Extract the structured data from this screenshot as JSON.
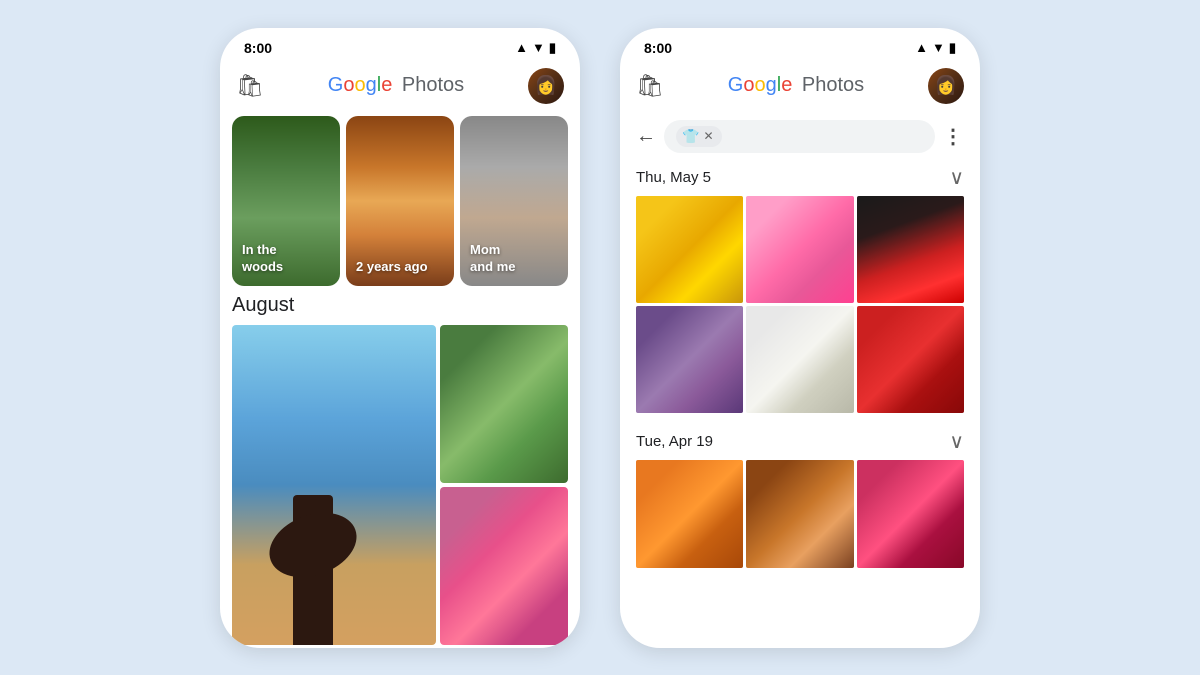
{
  "app": {
    "name": "Google Photos",
    "time": "8:00"
  },
  "phone1": {
    "memories": [
      {
        "id": "woods",
        "label": "In the\nwoods"
      },
      {
        "id": "years",
        "label": "2 years ago"
      },
      {
        "id": "mom",
        "label": "Mom\nand me"
      }
    ],
    "section_label": "August"
  },
  "phone2": {
    "search": {
      "chip_icon": "👕",
      "chip_label": "",
      "more_label": "⋮"
    },
    "dates": [
      {
        "label": "Thu, May 5",
        "photos": [
          "sunflower",
          "pink-bouquet",
          "red-flower",
          "people-group",
          "white-flower",
          "red-roses"
        ]
      },
      {
        "label": "Tue, Apr 19",
        "photos": [
          "wild-flowers",
          "woman-door",
          "pink-roses"
        ]
      }
    ]
  },
  "icons": {
    "back_arrow": "←",
    "expand": "∨",
    "bag": "🛍",
    "more": "⋮"
  }
}
